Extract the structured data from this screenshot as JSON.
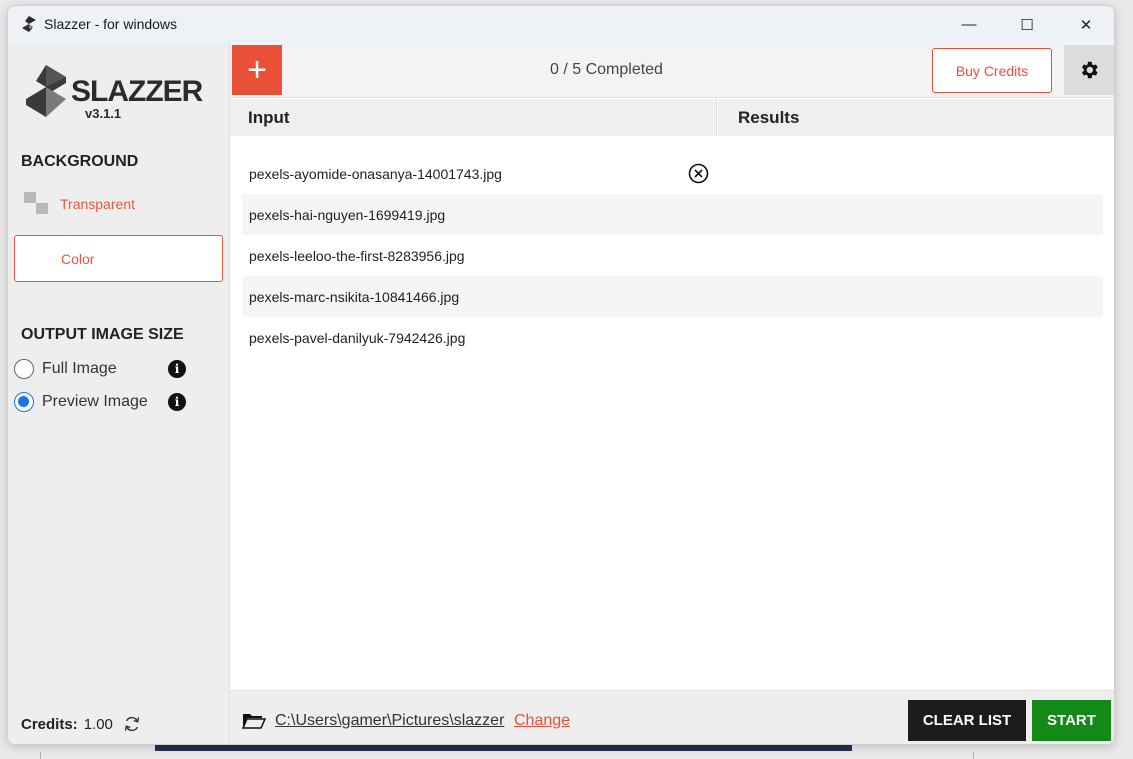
{
  "window": {
    "title": "Slazzer - for windows",
    "minimize_glyph": "—",
    "maximize_glyph": "☐",
    "close_glyph": "✕"
  },
  "sidebar": {
    "logo_text": "SLAZZER",
    "version": "v3.1.1",
    "background_title": "BACKGROUND",
    "transparent_label": "Transparent",
    "color_label": "Color",
    "output_size_title": "OUTPUT IMAGE SIZE",
    "size_options": [
      {
        "label": "Full Image",
        "checked": false
      },
      {
        "label": "Preview Image",
        "checked": true
      }
    ],
    "credits_label": "Credits:",
    "credits_value": "1.00"
  },
  "topbar": {
    "add_glyph": "+",
    "progress": "0 / 5 Completed",
    "buy_credits_label": "Buy Credits"
  },
  "columns": {
    "input": "Input",
    "results": "Results"
  },
  "files": [
    "pexels-ayomide-onasanya-14001743.jpg",
    "pexels-hai-nguyen-1699419.jpg",
    "pexels-leeloo-the-first-8283956.jpg",
    "pexels-marc-nsikita-10841466.jpg",
    "pexels-pavel-danilyuk-7942426.jpg"
  ],
  "bottombar": {
    "output_path": "C:\\Users\\gamer\\Pictures\\slazzer",
    "change_label": "Change",
    "clear_label": "CLEAR LIST",
    "start_label": "START"
  },
  "colors": {
    "accent": "#e9503a",
    "start": "#138a17",
    "clear": "#1c1c1c",
    "radio": "#1a73e8"
  },
  "icons": [
    "app-icon",
    "add-icon",
    "gear-icon",
    "info-icon",
    "remove-icon",
    "folder-icon",
    "refresh-icon",
    "checker-icon"
  ]
}
